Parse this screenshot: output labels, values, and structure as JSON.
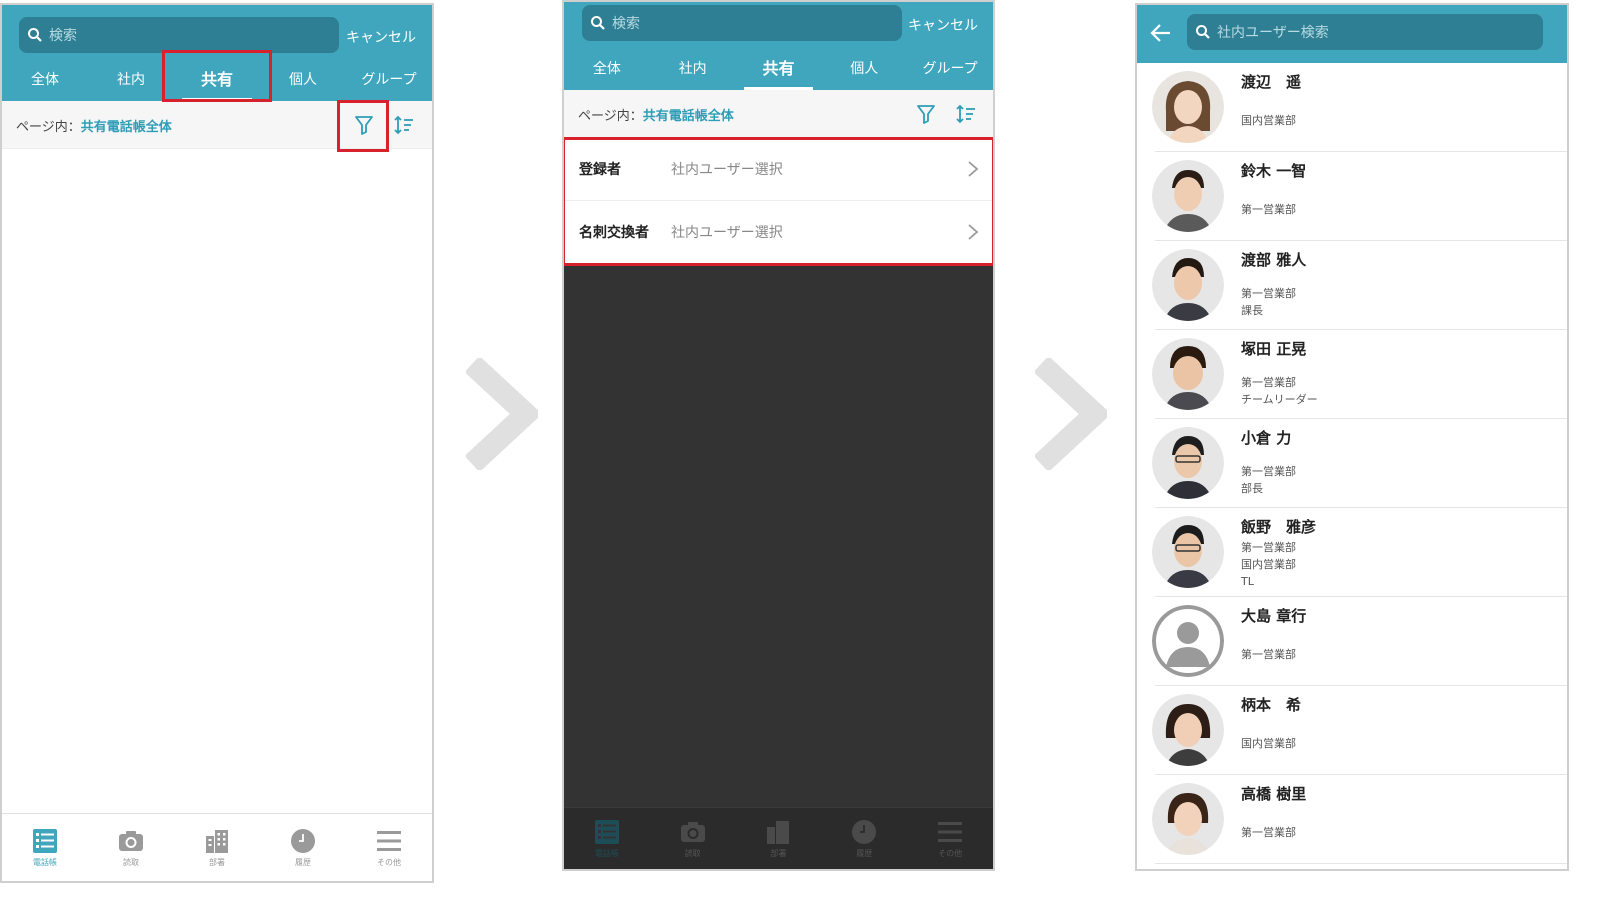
{
  "screen1": {
    "search_placeholder": "検索",
    "cancel": "キャンセル",
    "tabs": [
      "全体",
      "社内",
      "共有",
      "個人",
      "グループ"
    ],
    "active_tab": "共有",
    "page_label": "ページ内：",
    "page_value": "共有電話帳全体",
    "nav": [
      "電話帳",
      "読取",
      "部署",
      "履歴",
      "その他"
    ]
  },
  "screen2": {
    "search_placeholder": "検索",
    "cancel": "キャンセル",
    "tabs": [
      "全体",
      "社内",
      "共有",
      "個人",
      "グループ"
    ],
    "page_label": "ページ内：",
    "page_value": "共有電話帳全体",
    "filters": [
      {
        "key": "登録者",
        "value": "社内ユーザー選択"
      },
      {
        "key": "名刺交換者",
        "value": "社内ユーザー選択"
      }
    ],
    "nav": [
      "電話帳",
      "読取",
      "部署",
      "履歴",
      "その他"
    ]
  },
  "screen3": {
    "search_placeholder": "社内ユーザー検索",
    "users": [
      {
        "name": "渡辺　遥",
        "lines": [
          "国内営業部"
        ]
      },
      {
        "name": "鈴木 一智",
        "lines": [
          "第一営業部"
        ]
      },
      {
        "name": "渡部 雅人",
        "lines": [
          "第一営業部",
          "課長"
        ]
      },
      {
        "name": "塚田 正晃",
        "lines": [
          "第一営業部",
          "チームリーダー"
        ]
      },
      {
        "name": "小倉 力",
        "lines": [
          "第一営業部",
          "部長"
        ]
      },
      {
        "name": "飯野　雅彦",
        "lines": [
          "第一営業部",
          "国内営業部",
          "TL"
        ]
      },
      {
        "name": "大島 章行",
        "lines": [
          "第一営業部"
        ]
      },
      {
        "name": "柄本　希",
        "lines": [
          "国内営業部"
        ]
      },
      {
        "name": "高橋 樹里",
        "lines": [
          "第一営業部"
        ]
      }
    ]
  },
  "colors": {
    "primary": "#3fa6bd",
    "search": "#2e7f93",
    "highlight": "#d7222e",
    "link": "#2f9db8"
  }
}
